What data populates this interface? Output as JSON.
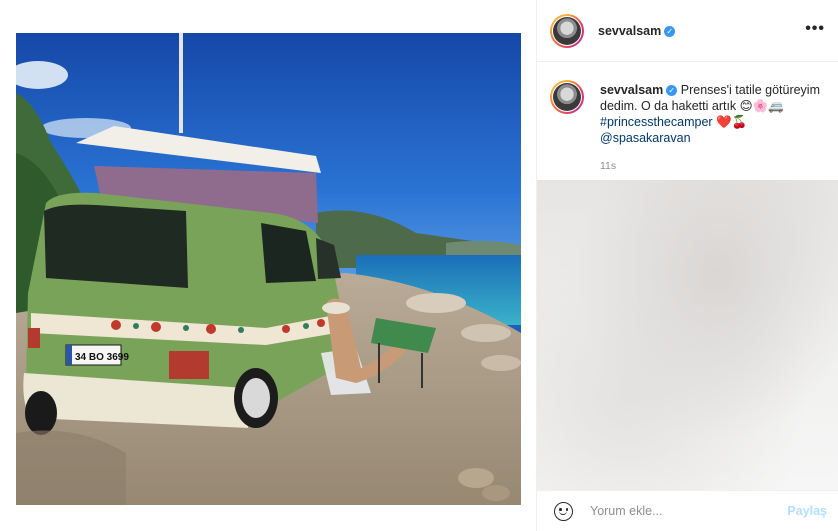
{
  "post": {
    "username": "sevvalsam",
    "verified_mark": "✓",
    "more_label": "•••",
    "caption": {
      "text": "Prenses'i tatile götüreyim dedim. O da haketti artık",
      "emojis": "😊🌸🚐",
      "hashtag": "#princessthecamper",
      "emojis2": "❤️🍒",
      "mention": "@spasakaravan"
    },
    "time": "11s"
  },
  "photo": {
    "plate": "34 BO 3699",
    "description_icon": "camper-van-photo"
  },
  "comment": {
    "placeholder": "Yorum ekle...",
    "post_label": "Paylaş"
  },
  "colors": {
    "link": "#00376b",
    "post_button_disabled": "#b2dffc",
    "verified": "#3897f0",
    "van_green": "#7aa35a"
  }
}
